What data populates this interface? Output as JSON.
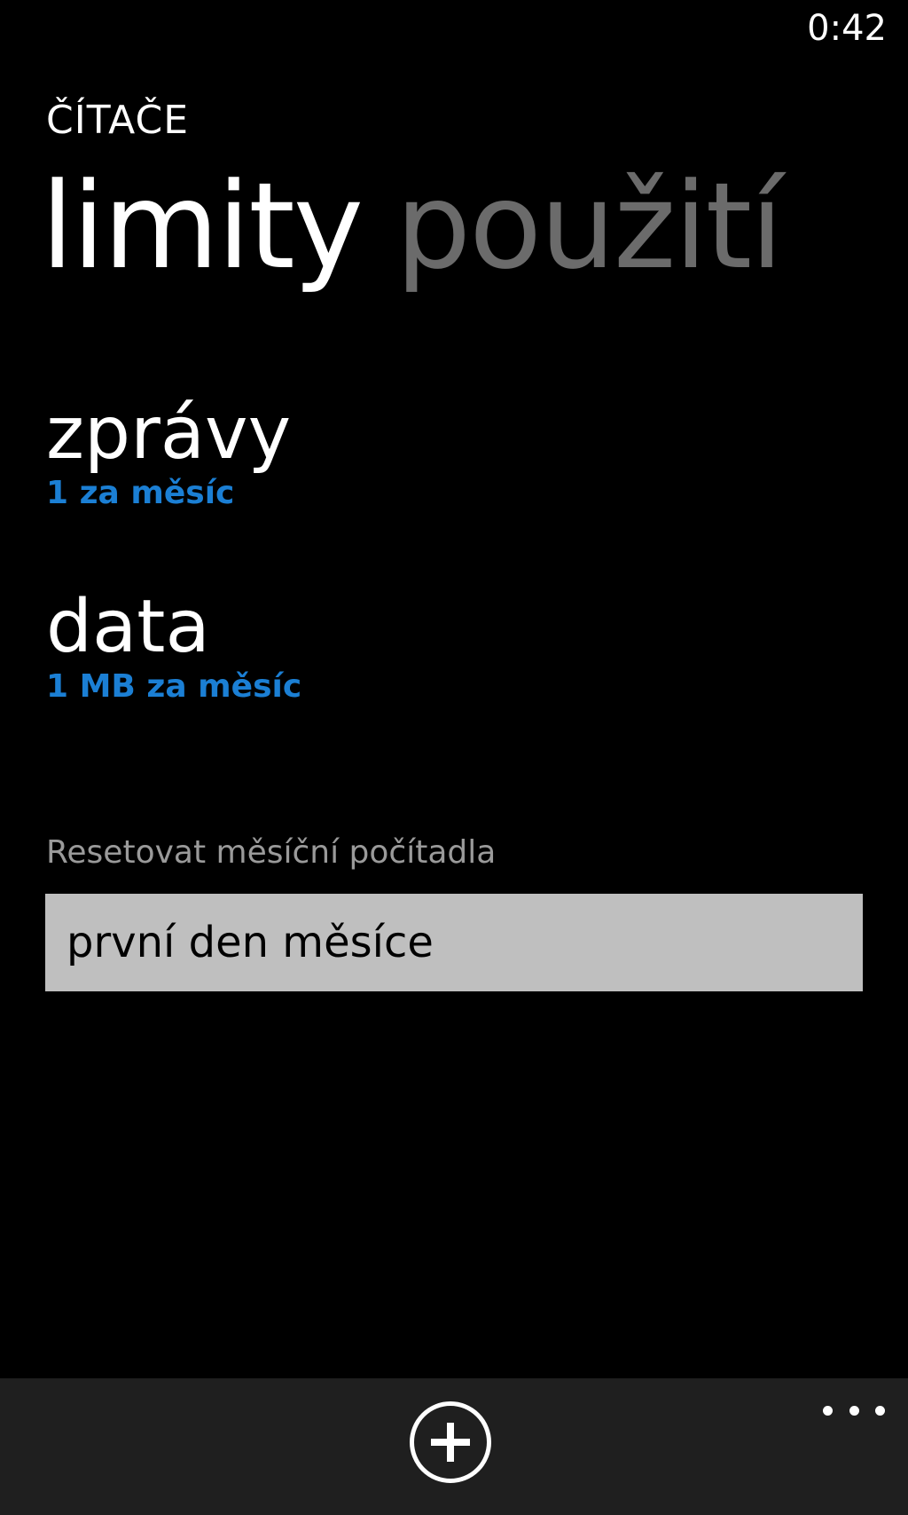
{
  "status_bar": {
    "time": "0:42"
  },
  "app": {
    "title": "ČÍTAČE"
  },
  "pivot": {
    "tabs": [
      {
        "label": "limity",
        "active": true
      },
      {
        "label": "použití",
        "active": false
      }
    ]
  },
  "limits": {
    "items": [
      {
        "title": "zprávy",
        "value": "1 za měsíc"
      },
      {
        "title": "data",
        "value": "1 MB za měsíc"
      }
    ]
  },
  "reset": {
    "label": "Resetovat měsíční počítadla",
    "selected": "první den měsíce"
  },
  "app_bar": {
    "icons": [
      "add-icon",
      "more-icon"
    ]
  },
  "colors": {
    "background": "#000000",
    "accent": "#1b7fd4",
    "picker_background": "#bfbfbf",
    "picker_text": "#000000",
    "app_bar": "#1f1f1f"
  }
}
